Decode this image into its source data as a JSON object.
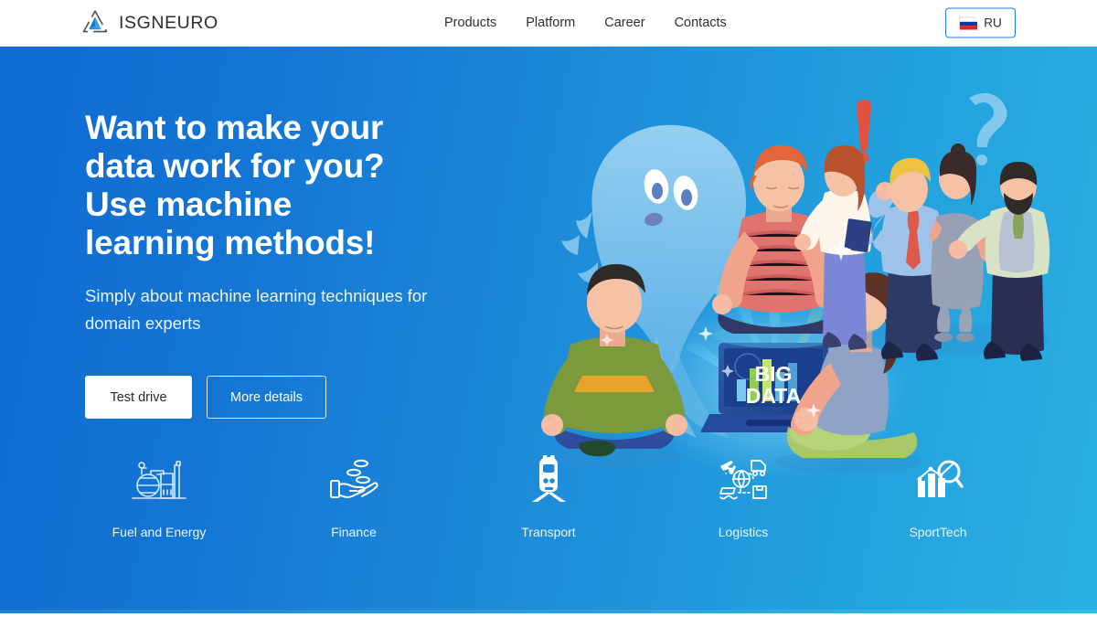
{
  "header": {
    "brand_name": "ISGNEURO",
    "logo_icon": "isgneuro-triangle-logo",
    "nav": [
      {
        "label": "Products"
      },
      {
        "label": "Platform"
      },
      {
        "label": "Career"
      },
      {
        "label": "Contacts"
      }
    ],
    "language": {
      "label": "RU",
      "flag_icon": "russia-flag-icon"
    }
  },
  "hero": {
    "title": "Want to make your\ndata work for you?\nUse machine\nlearning methods!",
    "subtitle": "Simply about machine learning techniques for\ndomain experts",
    "buttons": {
      "primary": "Test drive",
      "secondary": "More details"
    },
    "illustration_alt": "People meditating around a BIG DATA laptop with a data ghost and puzzled colleagues",
    "illustration_label": "BIG\nDATA",
    "colors": {
      "gradient_start": "#0f6ad2",
      "gradient_end": "#2cb0e2",
      "text": "#ffffff",
      "accent_button": "#ffffff"
    }
  },
  "categories": [
    {
      "label": "Fuel and Energy",
      "icon": "refinery-icon"
    },
    {
      "label": "Finance",
      "icon": "hand-coins-icon"
    },
    {
      "label": "Transport",
      "icon": "train-icon"
    },
    {
      "label": "Logistics",
      "icon": "logistics-network-icon"
    },
    {
      "label": "SportTech",
      "icon": "bar-chart-magnifier-icon"
    }
  ]
}
